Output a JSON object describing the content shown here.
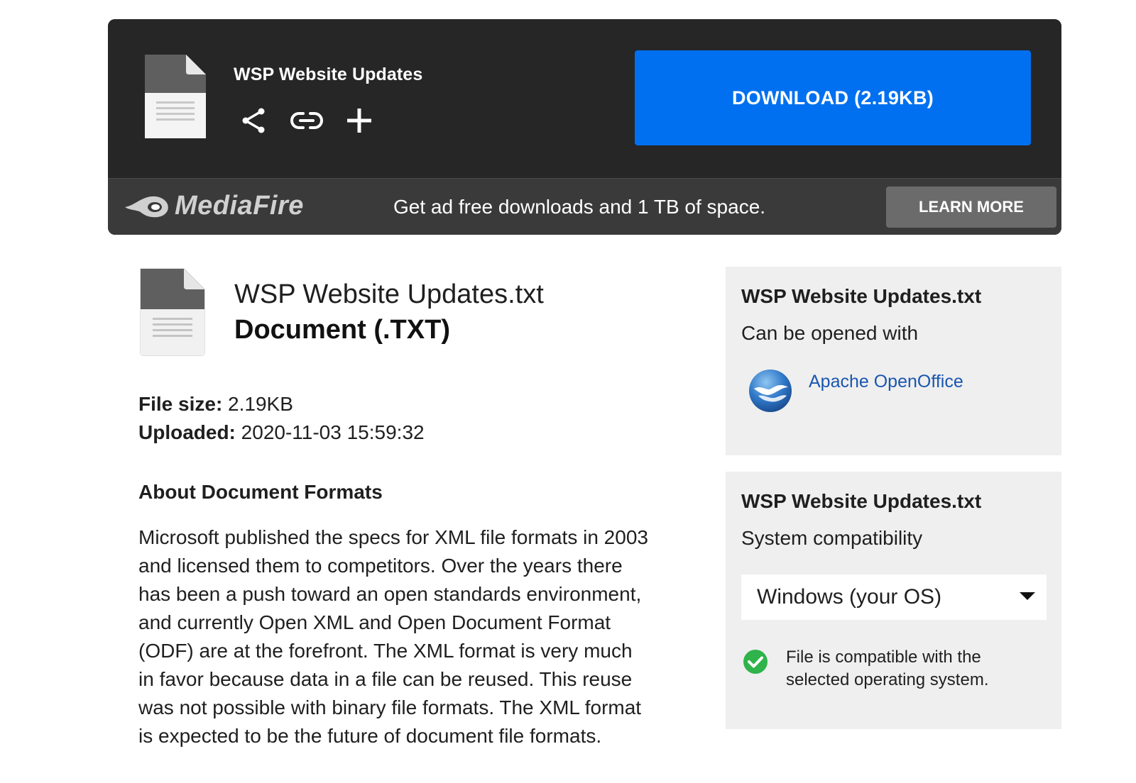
{
  "download_panel": {
    "title": "WSP Website Updates",
    "download_label": "DOWNLOAD (2.19KB)",
    "actions": [
      {
        "icon": "share-icon"
      },
      {
        "icon": "link-icon"
      },
      {
        "icon": "plus-icon"
      }
    ],
    "promo": {
      "brand": "MediaFire",
      "text": "Get ad free downloads and 1 TB of space.",
      "cta_label": "LEARN MORE"
    }
  },
  "file": {
    "name": "WSP Website Updates.txt",
    "type": "Document (.TXT)",
    "size_label": "File size:",
    "size_value": "2.19KB",
    "uploaded_label": "Uploaded:",
    "uploaded_value": "2020-11-03 15:59:32"
  },
  "about": {
    "title": "About Document Formats",
    "body": "Microsoft published the specs for XML file formats in 2003 and licensed them to competitors. Over the years there has been a push toward an open standards environment, and currently Open XML and Open Document Format (ODF) are at the forefront. The XML format is very much in favor because data in a file can be reused. This reuse was not possible with binary file formats. The XML format is expected to be the future of document file formats."
  },
  "sidebar": {
    "opened_with": {
      "title": "WSP Website Updates.txt",
      "subtitle": "Can be opened with",
      "app_name": "Apache OpenOffice"
    },
    "compatibility": {
      "title": "WSP Website Updates.txt",
      "subtitle": "System compatibility",
      "selected_os": "Windows (your OS)",
      "message": "File is compatible with the selected operating system."
    }
  },
  "colors": {
    "panel_bg": "#262626",
    "promo_bg": "#3a3a3a",
    "download_blue": "#0070f0",
    "learn_more_bg": "#6b6b6b",
    "link_blue": "#1a56b0",
    "card_bg": "#efefef",
    "check_green": "#2fb34a"
  }
}
